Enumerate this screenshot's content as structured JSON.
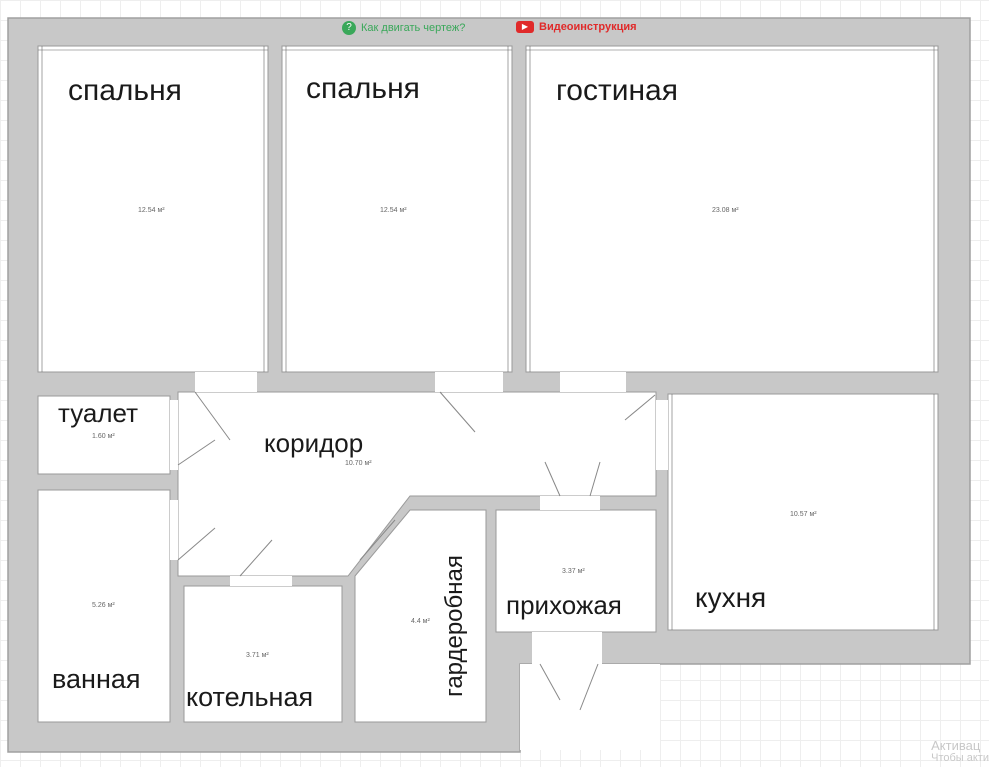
{
  "toolbar": {
    "help_link": "Как двигать чертеж?",
    "video_link": "Видеоинструкция",
    "help_color": "#3aa85a",
    "video_color": "#e02a2a"
  },
  "colors": {
    "wall": "#c8c8c8",
    "wall_edge": "#a9a9a9",
    "room": "#ffffff",
    "grid": "#eeeeee"
  },
  "rooms": {
    "bedroom1": {
      "name": "спальня",
      "area": "12.54 м²"
    },
    "bedroom2": {
      "name": "спальня",
      "area": "12.54 м²"
    },
    "living": {
      "name": "гостиная",
      "area": "23.08 м²"
    },
    "toilet": {
      "name": "туалет",
      "area": "1.60 м²"
    },
    "corridor": {
      "name": "коридор",
      "area": "10.70 м²"
    },
    "kitchen": {
      "name": "кухня",
      "area": "10.57 м²"
    },
    "bathroom": {
      "name": "ванная",
      "area": "5.26 м²"
    },
    "boiler": {
      "name": "котельная",
      "area": "3.71 м²"
    },
    "wardrobe": {
      "name": "гардеробная",
      "area": "4.4 м²"
    },
    "hallway": {
      "name": "прихожая",
      "area": "3.37 м²"
    }
  },
  "watermark": {
    "line1": "Активац",
    "line2": "Чтобы акти"
  }
}
